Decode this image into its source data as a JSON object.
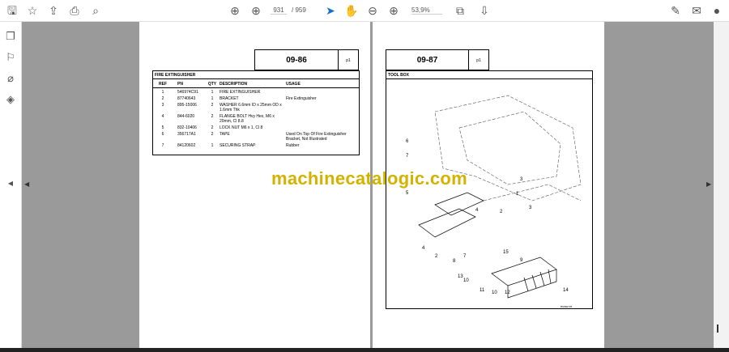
{
  "toolbar": {
    "current_page": "931",
    "total_pages": "/ 959",
    "zoom": "53,9%"
  },
  "left_page": {
    "page_code": "09-86",
    "page_mark": "p1",
    "section": "FIRE EXTINGUISHER",
    "headers": [
      "REF",
      "PN",
      "QTY",
      "DESCRIPTION",
      "USAGE"
    ],
    "rows": [
      [
        "1",
        "546974C91",
        "1",
        "FIRE EXTINGUISHER",
        ""
      ],
      [
        "2",
        "87740643",
        "1",
        "BRACKET",
        "Fire Extinguisher"
      ],
      [
        "3",
        "895-15006",
        "2",
        "WASHER 6.6mm ID x 25mm OD x 1.6mm Thk",
        ""
      ],
      [
        "4",
        "844-6020",
        "2",
        "FLANGE BOLT Hvy Hex, M6 x 20mm, Cl 8.8",
        ""
      ],
      [
        "5",
        "832-10406",
        "2",
        "LOCK NUT M6 x 1, Cl 8",
        ""
      ],
      [
        "6",
        "356717A1",
        "2",
        "TAPE",
        "Used On Top Of Fire Extinguisher Bracket, Not Illustrated"
      ],
      [
        "7",
        "84120602",
        "1",
        "SECURING STRAP",
        "Rubber"
      ]
    ]
  },
  "right_page": {
    "page_code": "09-87",
    "page_mark": "p1",
    "section": "TOOL BOX",
    "callouts": [
      "6",
      "7",
      "5",
      "3",
      "1",
      "4",
      "3",
      "2",
      "4",
      "2",
      "7",
      "8",
      "15",
      "9",
      "13",
      "10",
      "11",
      "10",
      "12",
      "14"
    ],
    "figure_id": "BS09E735"
  },
  "watermark": "machinecatalogic.com"
}
